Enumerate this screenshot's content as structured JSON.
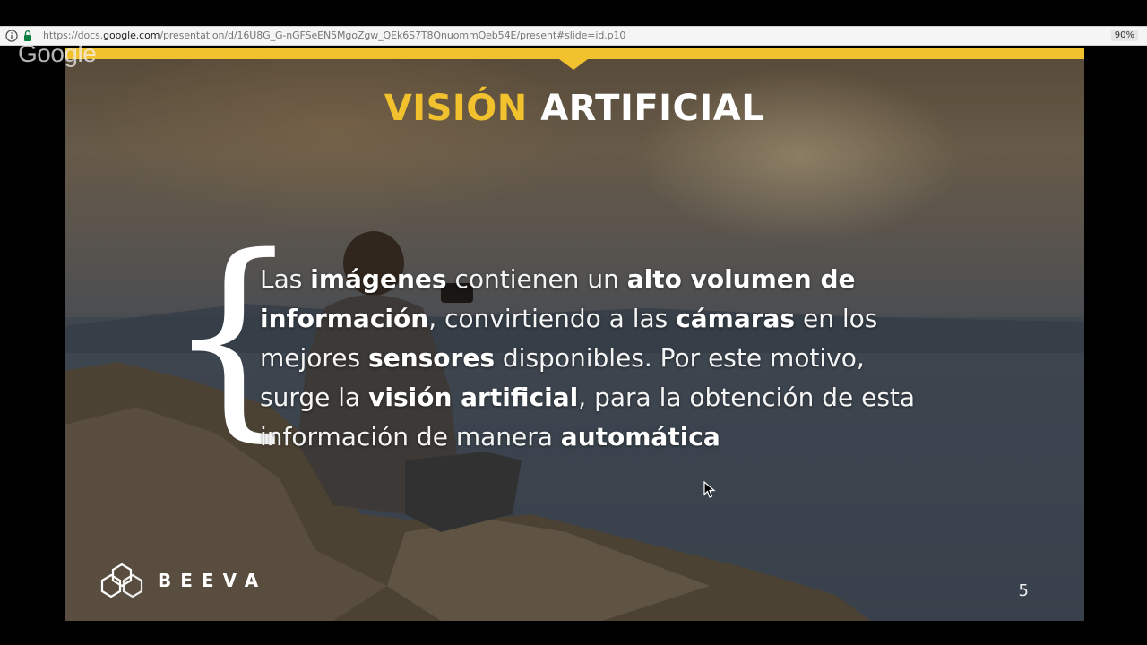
{
  "browser": {
    "url_prefix": "https://docs.",
    "url_host": "google.com",
    "url_rest": "/presentation/d/16U8G_G-nGFSeEN5MgoZgw_QEk6S7T8QnuommQeb54E/present#slide=id.p10",
    "zoom": "90%"
  },
  "watermark": {
    "logo": "Google"
  },
  "slide": {
    "title_accent": "VISIÓN",
    "title_rest": "ARTIFICIAL",
    "brace": "{",
    "body": {
      "t1": "Las ",
      "b1": "imágenes",
      "t2": " contienen un ",
      "b2": "alto volumen de información",
      "t3": ", convirtiendo a las ",
      "b3": "cámaras",
      "t4": " en los mejores ",
      "b4": "sensores",
      "t5": " disponibles. Por este motivo, surge la ",
      "b5": "visión artificial",
      "t6": ", para la obtención de esta información de manera ",
      "b6": "automática"
    },
    "brand": "BEEVA",
    "page_number": "5"
  },
  "colors": {
    "accent": "#f2c22e",
    "text": "#ffffff"
  },
  "icons": [
    "info-icon",
    "lock-icon",
    "beeva-hexagon-logo",
    "mouse-cursor-icon"
  ]
}
